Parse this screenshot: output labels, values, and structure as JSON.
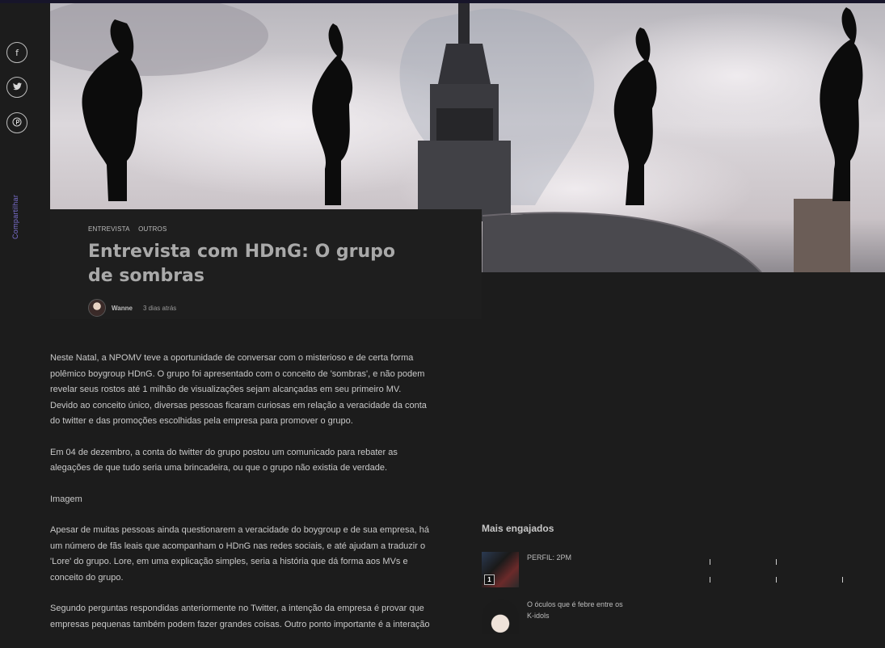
{
  "share": {
    "label": "Compartilhar",
    "buttons": [
      {
        "name": "facebook",
        "glyph": "f"
      },
      {
        "name": "twitter",
        "glyph": "❖"
      },
      {
        "name": "pinterest",
        "glyph": "Ⓟ"
      }
    ]
  },
  "hero": {
    "icon": "shadow-figures-image"
  },
  "post": {
    "categories": [
      "ENTREVISTA",
      "OUTROS"
    ],
    "title": "Entrevista com HDnG: O grupo de sombras",
    "author": "Wanne",
    "time": "3 dias atrás"
  },
  "article": {
    "paragraphs": [
      "Neste Natal, a NPOMV teve a oportunidade de conversar com o misterioso e de certa forma polêmico boygroup HDnG. O grupo foi apresentado com o conceito de 'sombras', e não podem revelar seus rostos até 1 milhão de visualizações sejam alcançadas em seu primeiro MV. Devido ao conceito único, diversas pessoas ficaram curiosas em relação a veracidade da conta do twitter e das promoções escolhidas pela empresa para promover o grupo.",
      "Em 04 de dezembro, a conta do twitter do grupo postou um comunicado para rebater as alegações de que tudo seria uma brincadeira, ou que o grupo não existia de verdade.",
      "Imagem",
      "Apesar de muitas pessoas ainda questionarem a veracidade do boygroup e de sua empresa, há um número de fãs leais que acompanham o HDnG nas redes sociais, e até ajudam a traduzir o 'Lore' do grupo. Lore, em uma explicação simples, seria a história que dá forma aos MVs e conceito do grupo.",
      "Segundo perguntas respondidas anteriormente no Twitter, a intenção da empresa é provar que empresas pequenas também podem fazer grandes coisas. Outro ponto importante é a interação"
    ]
  },
  "sidebar": {
    "heading": "Mais engajados",
    "posts": [
      {
        "rank": "1",
        "title": "PERFIL: 2PM"
      },
      {
        "rank": "",
        "title": "O óculos que é febre entre os K-idols"
      }
    ]
  },
  "colors": {
    "accent": "#7b6fd0",
    "background": "#1c1c1c",
    "card": "#1e1e1e"
  }
}
